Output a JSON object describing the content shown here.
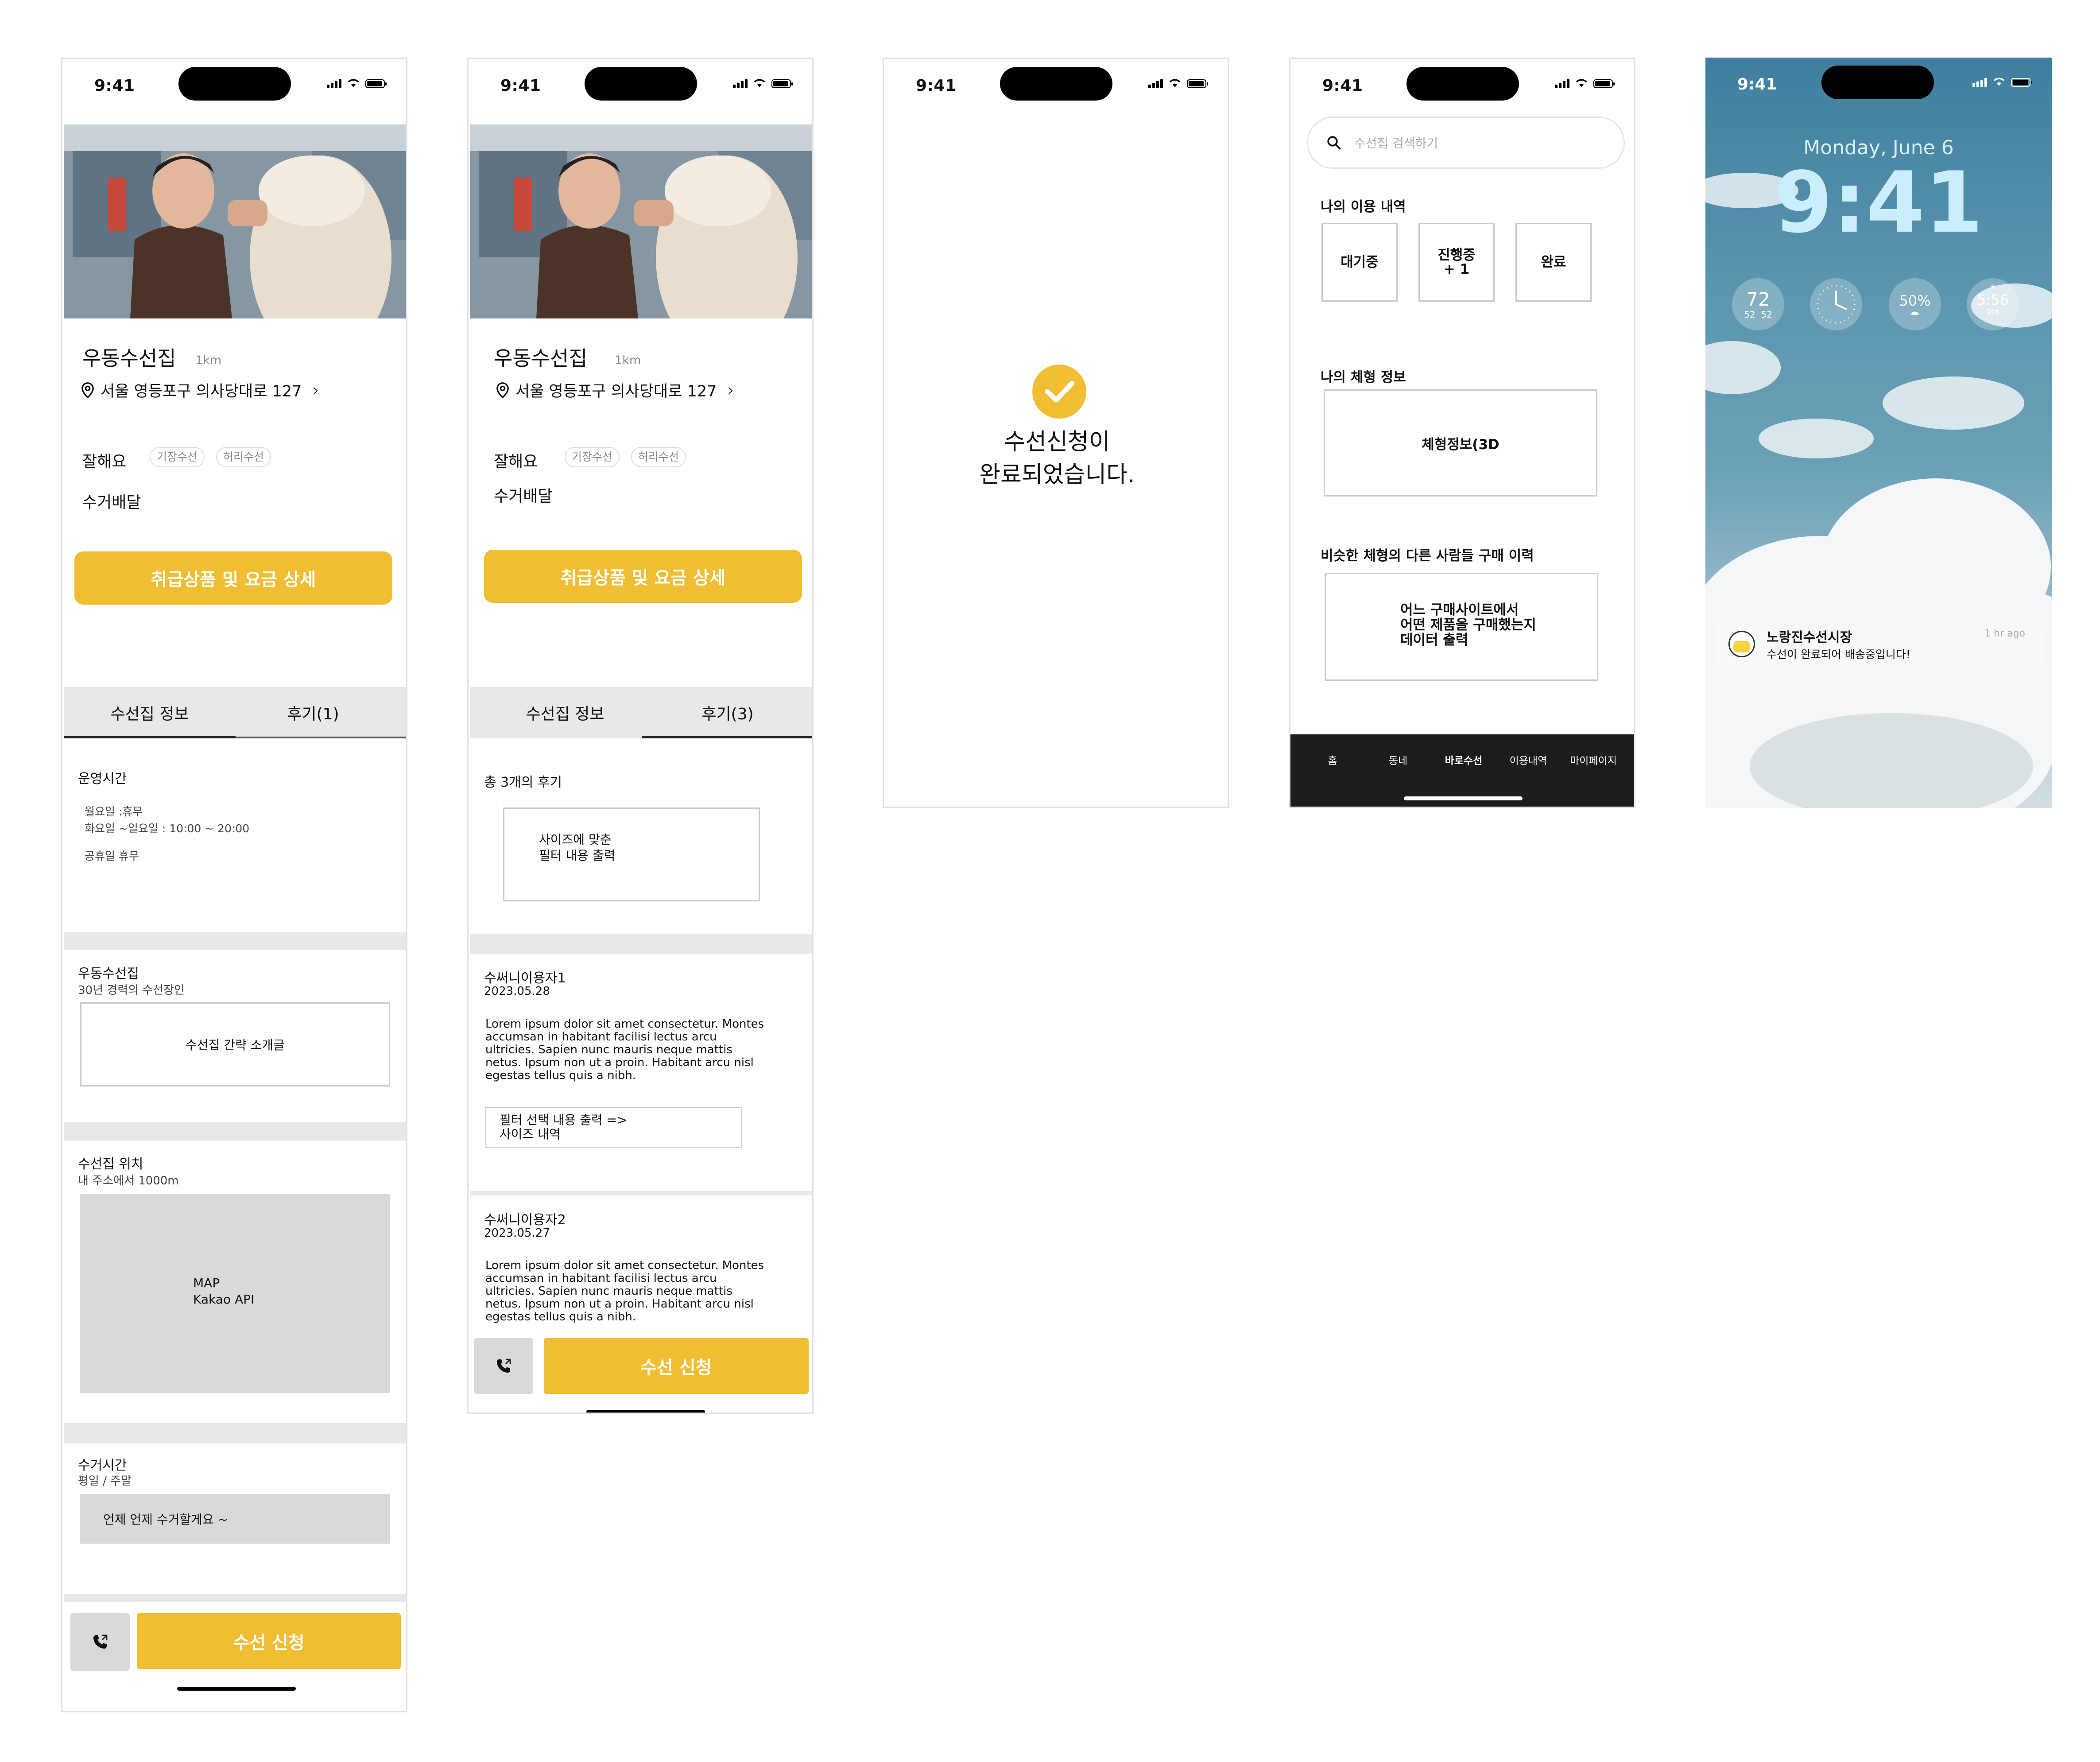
{
  "status_bar": {
    "time": "9:41"
  },
  "shop": {
    "name": "우동수선집",
    "distance": "1km",
    "address": "서울 영등포구 의사당대로 127",
    "good_at_label": "잘해요",
    "tags": [
      "기장수선",
      "허리수선"
    ],
    "pickup_label": "수거배달",
    "detail_button": "취급상품 및 요금 상세",
    "apply_button": "수선 신청"
  },
  "screen1": {
    "tab_info": "수선집 정보",
    "tab_reviews": "후기(1)",
    "hours_title": "운영시간",
    "hours_lines": [
      "월요일 :휴무",
      "화요일 ~일요일 : 10:00 ~ 20:00",
      "공휴일 휴무"
    ],
    "intro_title": "우동수선집",
    "intro_sub": "30년 경력의 수선장인",
    "intro_box": "수선집 간략 소개글",
    "location_title": "수선집 위치",
    "location_sub": "내 주소에서 1000m",
    "map_line1": "MAP",
    "map_line2": "Kakao API",
    "pickup_time_title": "수거시간",
    "pickup_time_sub": "평일 / 주말",
    "pickup_time_box": "언제 언제 수거할게요 ~"
  },
  "screen2": {
    "tab_info": "수선집 정보",
    "tab_reviews": "후기(3)",
    "review_count": "총 3개의 후기",
    "filter_box_line1": "사이즈에 맞춘",
    "filter_box_line2": "필터 내용 출력",
    "reviews": [
      {
        "user": "수써니이용자1",
        "date": "2023.05.28",
        "text": "Lorem ipsum dolor sit amet consectetur. Montes accumsan in habitant facilisi lectus arcu ultricies. Sapien nunc mauris neque mattis netus. Ipsum non ut a proin. Habitant arcu nisl egestas tellus quis a nibh.",
        "filter_line1": "필터 선택 내용 출력 =>",
        "filter_line2": "사이즈 내역"
      },
      {
        "user": "수써니이용자2",
        "date": "2023.05.27",
        "text": "Lorem ipsum dolor sit amet consectetur. Montes accumsan in habitant facilisi lectus arcu ultricies. Sapien nunc mauris neque mattis netus. Ipsum non ut a proin. Habitant arcu nisl egestas tellus quis a nibh."
      }
    ]
  },
  "screen3": {
    "message_line1": "수선신청이",
    "message_line2": "완료되었습니다.",
    "accent": "#f0bd33"
  },
  "screen4": {
    "search_placeholder": "수선집 검색하기",
    "history_title": "나의 이용 내역",
    "status_waiting": "대기중",
    "status_progress_line1": "진행중",
    "status_progress_line2": "+ 1",
    "status_done": "완료",
    "body_title": "나의 체형 정보",
    "body_box": "체형정보(3D",
    "similar_title": "비슷한 체형의 다른 사람들 구매 이력",
    "similar_line1": "어느 구매사이트에서",
    "similar_line2": "어떤 제품을 구매했는지",
    "similar_line3": "데이터 출력",
    "nav": [
      "홈",
      "동네",
      "바로수선",
      "이용내역",
      "마이페이지"
    ]
  },
  "lock_screen": {
    "date": "Monday, June 6",
    "time": "9:41",
    "widget_temp": "72",
    "widget_temp_range": "52  52",
    "widget_battery": "50%",
    "widget_sunset": "5:56",
    "widget_sunset_ampm": "PM",
    "notification_app": "노랑진수선시장",
    "notification_time": "1 hr ago",
    "notification_body": "수선이 완료되어 배송중입니다!"
  },
  "colors": {
    "accent": "#f0bd33",
    "nav_bg": "#1c1c1c",
    "gray": "#e8e8e8"
  }
}
